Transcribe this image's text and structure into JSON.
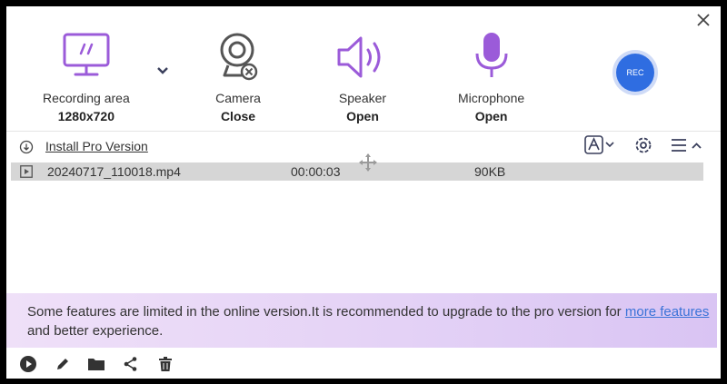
{
  "toolbar": {
    "recording_area": {
      "label": "Recording area",
      "value": "1280x720",
      "icon": "monitor-icon"
    },
    "camera": {
      "label": "Camera",
      "value": "Close",
      "icon": "webcam-icon"
    },
    "speaker": {
      "label": "Speaker",
      "value": "Open",
      "icon": "speaker-icon"
    },
    "microphone": {
      "label": "Microphone",
      "value": "Open",
      "icon": "microphone-icon"
    },
    "rec_label": "REC"
  },
  "links": {
    "install_pro": "Install Pro Version"
  },
  "files": [
    {
      "name": "20240717_110018.mp4",
      "duration": "00:00:03",
      "size": "90KB"
    }
  ],
  "banner": {
    "text_before": "Some features are limited in the online version.It is recommended to upgrade to the pro version for ",
    "link": "more features",
    "text_after": " and better experience."
  },
  "colors": {
    "accent_purple": "#9b5bd9",
    "rec_blue": "#2f6de1",
    "link_blue": "#3b73d8"
  }
}
